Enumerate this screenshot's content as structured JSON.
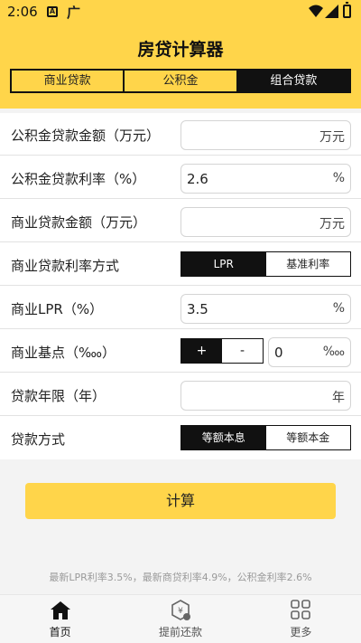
{
  "status_bar": {
    "time": "2:06",
    "a_glyph": "A",
    "app_glyph": "广"
  },
  "header": {
    "title": "房贷计算器"
  },
  "tabs": [
    {
      "label": "商业贷款",
      "active": false
    },
    {
      "label": "公积金",
      "active": false
    },
    {
      "label": "组合贷款",
      "active": true
    }
  ],
  "form": {
    "fund_amount": {
      "label": "公积金贷款金额（万元）",
      "value": "",
      "unit": "万元"
    },
    "fund_rate": {
      "label": "公积金贷款利率（%）",
      "value": "2.6",
      "unit": "%"
    },
    "commercial_amount": {
      "label": "商业贷款金额（万元）",
      "value": "",
      "unit": "万元"
    },
    "rate_mode": {
      "label": "商业贷款利率方式",
      "options": [
        "LPR",
        "基准利率"
      ],
      "selected": "LPR"
    },
    "lpr": {
      "label": "商业LPR（%）",
      "value": "3.5",
      "unit": "%"
    },
    "basis_points": {
      "label": "商业基点（‱）",
      "plus": "+",
      "minus": "-",
      "value": "0",
      "unit": "‱"
    },
    "years": {
      "label": "贷款年限（年）",
      "value": "",
      "unit": "年"
    },
    "repay_method": {
      "label": "贷款方式",
      "options": [
        "等额本息",
        "等额本金"
      ],
      "selected": "等额本息"
    }
  },
  "calculate_button": "计算",
  "footer_note": "最新LPR利率3.5%，最新商贷利率4.9%，公积金利率2.6%",
  "bottom_nav": [
    {
      "label": "首页",
      "icon": "home-icon",
      "active": true
    },
    {
      "label": "提前还款",
      "icon": "coin-badge-icon",
      "active": false
    },
    {
      "label": "更多",
      "icon": "grid-icon",
      "active": false
    }
  ],
  "colors": {
    "accent": "#ffd54a",
    "selected": "#111111"
  }
}
